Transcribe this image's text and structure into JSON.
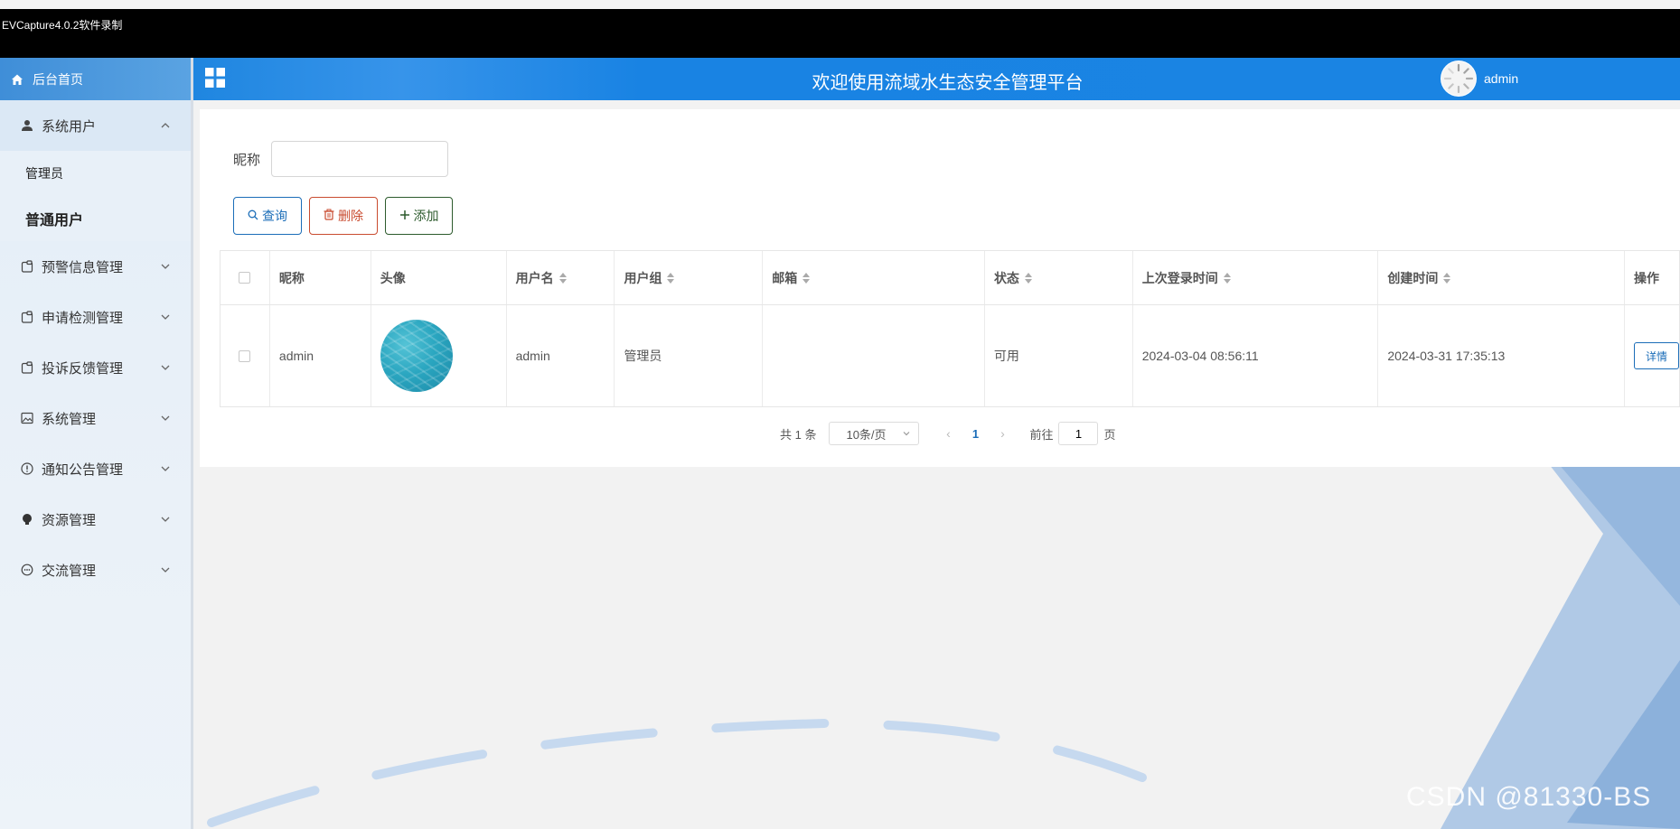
{
  "recording": {
    "title": "EVCapture4.0.2软件录制"
  },
  "sidebar": {
    "home_label": "后台首页",
    "groups": [
      {
        "label": "系统用户",
        "icon": "user-icon",
        "expanded": true,
        "children": [
          {
            "label": "管理员"
          },
          {
            "label": "普通用户"
          }
        ]
      },
      {
        "label": "预警信息管理",
        "icon": "clipboard-icon"
      },
      {
        "label": "申请检测管理",
        "icon": "clipboard-icon"
      },
      {
        "label": "投诉反馈管理",
        "icon": "clipboard-icon"
      },
      {
        "label": "系统管理",
        "icon": "image-icon"
      },
      {
        "label": "通知公告管理",
        "icon": "info-circle-icon"
      },
      {
        "label": "资源管理",
        "icon": "bulb-icon"
      },
      {
        "label": "交流管理",
        "icon": "chat-icon"
      }
    ]
  },
  "header": {
    "title": "欢迎使用流域水生态安全管理平台",
    "username": "admin"
  },
  "search": {
    "nickname_label": "昵称",
    "nickname_value": ""
  },
  "toolbar": {
    "query_label": "查询",
    "delete_label": "删除",
    "add_label": "添加"
  },
  "table": {
    "columns": {
      "nickname": "昵称",
      "avatar": "头像",
      "username": "用户名",
      "group": "用户组",
      "email": "邮箱",
      "status": "状态",
      "last_login": "上次登录时间",
      "created": "创建时间",
      "actions": "操作"
    },
    "rows": [
      {
        "nickname": "admin",
        "username": "admin",
        "group": "管理员",
        "email": "",
        "status": "可用",
        "last_login": "2024-03-04 08:56:11",
        "created": "2024-03-31 17:35:13",
        "action_label": "详情"
      }
    ]
  },
  "pagination": {
    "total_text": "共 1 条",
    "page_size": "10条/页",
    "current_page": "1",
    "goto_prefix": "前往",
    "goto_value": "1",
    "goto_suffix": "页"
  },
  "watermark": "CSDN @81330-BS",
  "colors": {
    "header_blue": "#1a84e3",
    "primary": "#1b6db8",
    "danger": "#c94b2f",
    "success": "#2d5b2d"
  }
}
